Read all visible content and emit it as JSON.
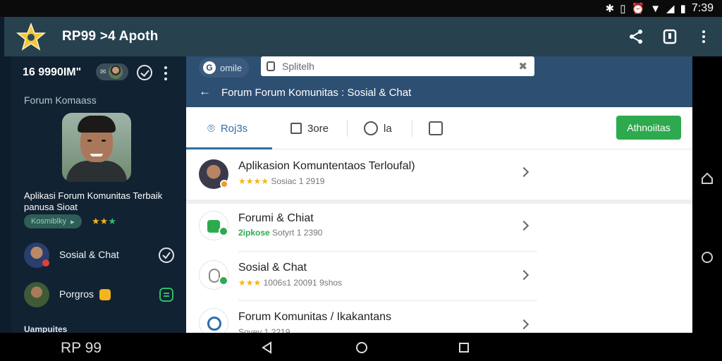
{
  "status_bar": {
    "time": "7:39"
  },
  "app_bar": {
    "title": "RP99 >4 Apoth"
  },
  "left_panel": {
    "count": "16 9990IM\"",
    "section_title": "Forum Komaass",
    "profile_description": "Aplikasi Forum Komunitas Terbaik panusa Sioat",
    "badge": "Kosmiblky",
    "items": [
      {
        "label": "Sosial & Chat"
      },
      {
        "label": "Porgros"
      }
    ],
    "footer": "Uampuites"
  },
  "right_pane": {
    "search_chip": "omile",
    "search_placeholder": "Splitelh",
    "title": "Forum Forum Komunitas : Sosial & Chat",
    "tabs": [
      {
        "label": "Roj3s"
      },
      {
        "label": "3ore"
      },
      {
        "label": "la"
      },
      {
        "label": ""
      }
    ],
    "cta": "Athnoiitas",
    "rows": [
      {
        "title": "Aplikasion Komuntentaos Terloufal)",
        "sub": "Sosiac 1 2919",
        "rating": 4
      },
      {
        "title": "Forumi & Chiat",
        "sub_tag": "2ipkose",
        "sub": "Sotyrt 1 2390"
      },
      {
        "title": "Sosial & Chat",
        "sub": "1006s1 20091 9shos",
        "rating": 3
      },
      {
        "title": "Forum Komunitas / Ikakantans",
        "sub": "Sovev 1 2219"
      }
    ]
  },
  "bottom_bar": {
    "brand": "RP 99"
  },
  "colors": {
    "appbar": "#27414f",
    "left_panel": "#112232",
    "header_blue": "#2d4f72",
    "accent_blue": "#2d6ea8",
    "cta_green": "#2eaa4e",
    "star": "#f3b51b"
  }
}
